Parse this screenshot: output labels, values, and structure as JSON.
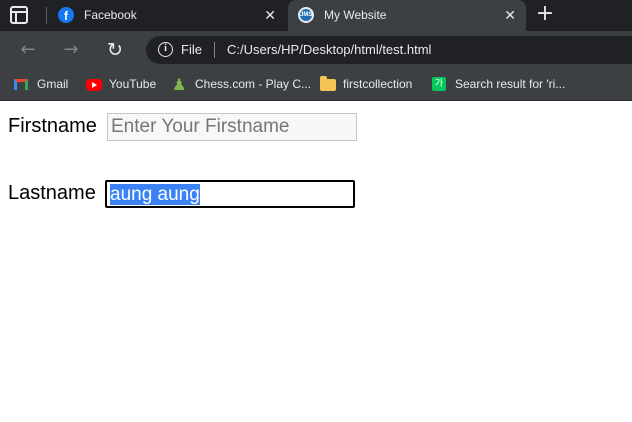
{
  "browser": {
    "tabs": [
      {
        "title": "Facebook",
        "favicon": "facebook-icon",
        "active": false
      },
      {
        "title": "My Website",
        "favicon": "website-icon",
        "favicon_text": "JMS",
        "active": true
      }
    ],
    "close_glyph": "✕",
    "new_tab_glyph": "+",
    "address_bar": {
      "scheme_label": "File",
      "url": "C:/Users/HP/Desktop/html/test.html"
    },
    "bookmarks": [
      {
        "label": "Gmail",
        "icon": "gmail-icon"
      },
      {
        "label": "YouTube",
        "icon": "youtube-icon"
      },
      {
        "label": "Chess.com - Play C...",
        "icon": "chess-pawn-icon"
      },
      {
        "label": "firstcollection",
        "icon": "folder-icon"
      },
      {
        "label": "Search result for 'ri...",
        "icon": "naver-search-icon",
        "icon_text": "가"
      }
    ],
    "colors": {
      "tabstrip_bg": "#202124",
      "toolbar_bg": "#3c4043",
      "selection": "#3b82f6"
    }
  },
  "page": {
    "firstname": {
      "label": "Firstname",
      "placeholder": "Enter Your Firstname",
      "value": ""
    },
    "lastname": {
      "label": "Lastname",
      "value": "aung aung",
      "focused": true,
      "text_selected": true
    }
  }
}
